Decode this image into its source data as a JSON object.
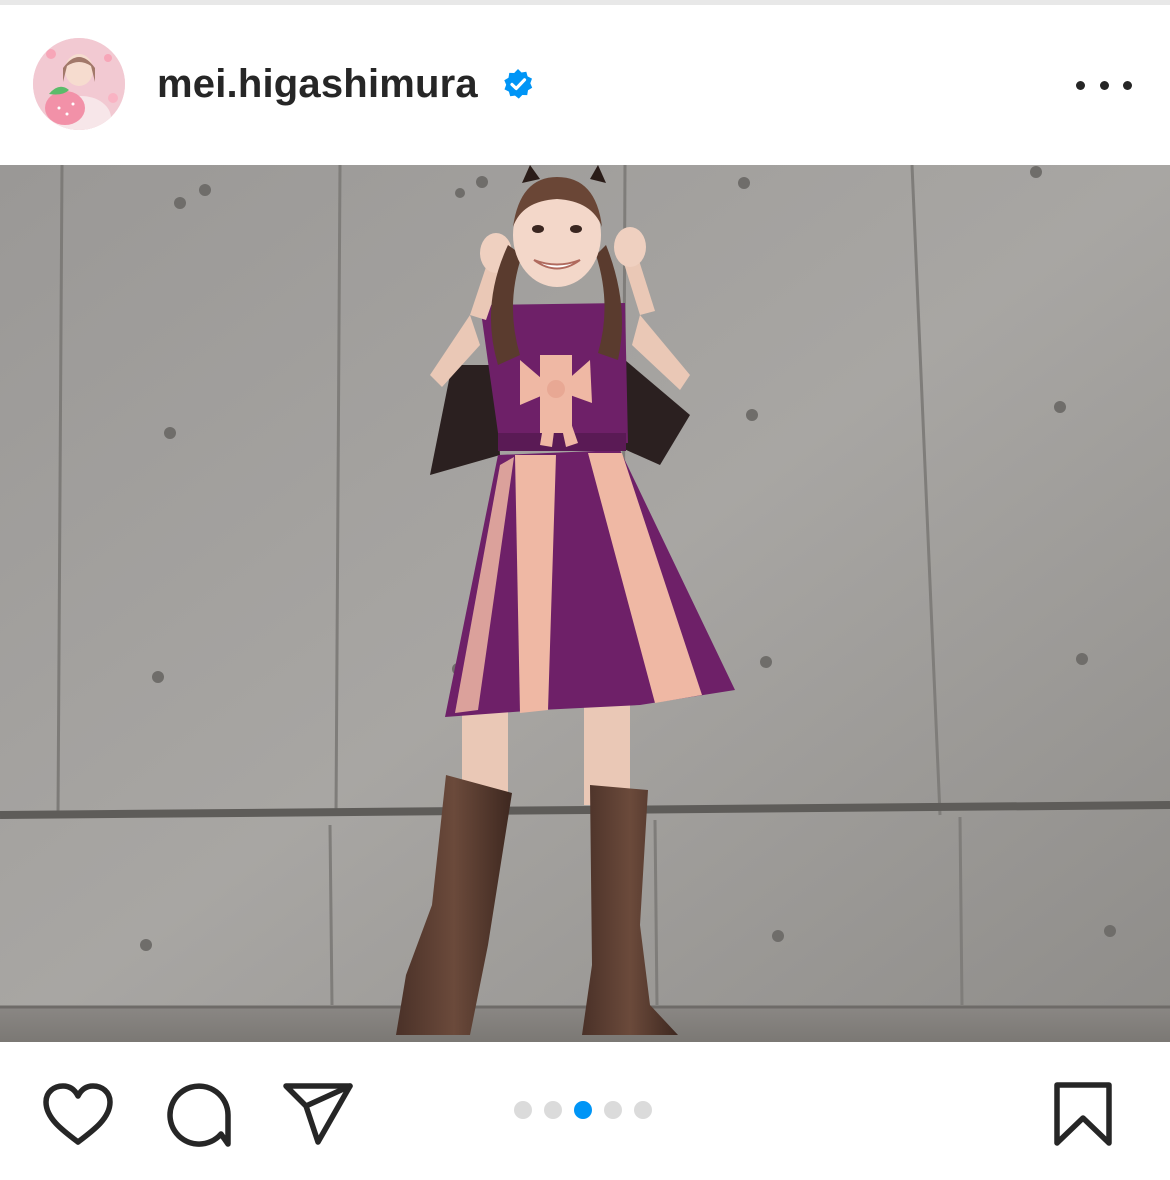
{
  "post": {
    "username": "mei.higashimura",
    "verified": true,
    "colors": {
      "verified": "#0095f6",
      "text": "#262626",
      "dot_active": "#0095f6",
      "dot_inactive": "#dbdbdb"
    }
  },
  "header": {
    "avatar_icon": "profile-avatar",
    "verified_icon": "verified-badge-icon",
    "menu_icon": "more-options-icon"
  },
  "actions": {
    "like_icon": "heart-icon",
    "comment_icon": "comment-bubble-icon",
    "share_icon": "paper-plane-icon",
    "save_icon": "bookmark-icon"
  },
  "carousel": {
    "count": 5,
    "active_index": 2
  }
}
